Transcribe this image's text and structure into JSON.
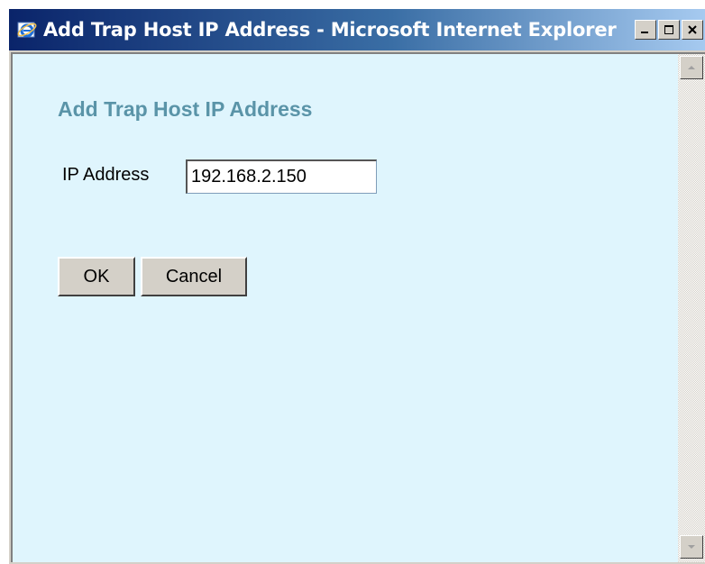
{
  "window": {
    "title": "Add Trap Host IP Address - Microsoft Internet Explorer",
    "icon": "internet-explorer-icon",
    "controls": [
      "minimize",
      "maximize",
      "close"
    ]
  },
  "page": {
    "heading": "Add Trap Host IP Address",
    "ip_label": "IP Address",
    "ip_value": "192.168.2.150",
    "ok_label": "OK",
    "cancel_label": "Cancel"
  },
  "colors": {
    "titlebar_start": "#0a246a",
    "titlebar_end": "#a6caf0",
    "page_background": "#dff5fd",
    "heading": "#5a94a8"
  }
}
